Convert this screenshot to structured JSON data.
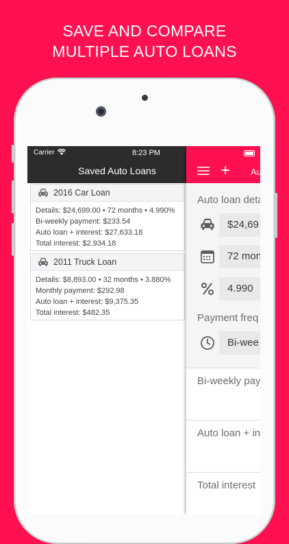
{
  "headline": {
    "line1": "SAVE AND COMPARE",
    "line2": "MULTIPLE AUTO LOANS"
  },
  "colors": {
    "brand": "#FF1050",
    "navbar_dark": "#2c2c2e"
  },
  "status_bar": {
    "carrier": "Carrier",
    "time": "8:23 PM"
  },
  "saved_list": {
    "title": "Saved Auto Loans",
    "loans": [
      {
        "icon": "car-icon",
        "name": "2016 Car Loan",
        "details": "Details: $24,699.00 • 72 months • 4.990%",
        "payment": "Bi-weekly payment: $233.54",
        "loan_plus_interest": "Auto loan + interest:  $27,633.18",
        "total_interest": "Total interest: $2,934.18"
      },
      {
        "icon": "car-icon",
        "name": "2011 Truck Loan",
        "details": "Details: $8,893.00 • 32 months • 3.880%",
        "payment": "Monthly payment: $292.98",
        "loan_plus_interest": "Auto loan + interest:  $9,375.35",
        "total_interest": "Total interest: $482.35"
      }
    ]
  },
  "calculator": {
    "nav_title": "Au",
    "section_details": "Auto loan deta",
    "amount_value": "$24,69",
    "term_value": "72 mon",
    "rate_value": "4.990",
    "section_frequency": "Payment freq",
    "frequency_value": "Bi-wee",
    "result_payment_label": "Bi-weekly pay",
    "result_total_label": "Auto loan + in",
    "result_interest_label": "Total interest"
  }
}
